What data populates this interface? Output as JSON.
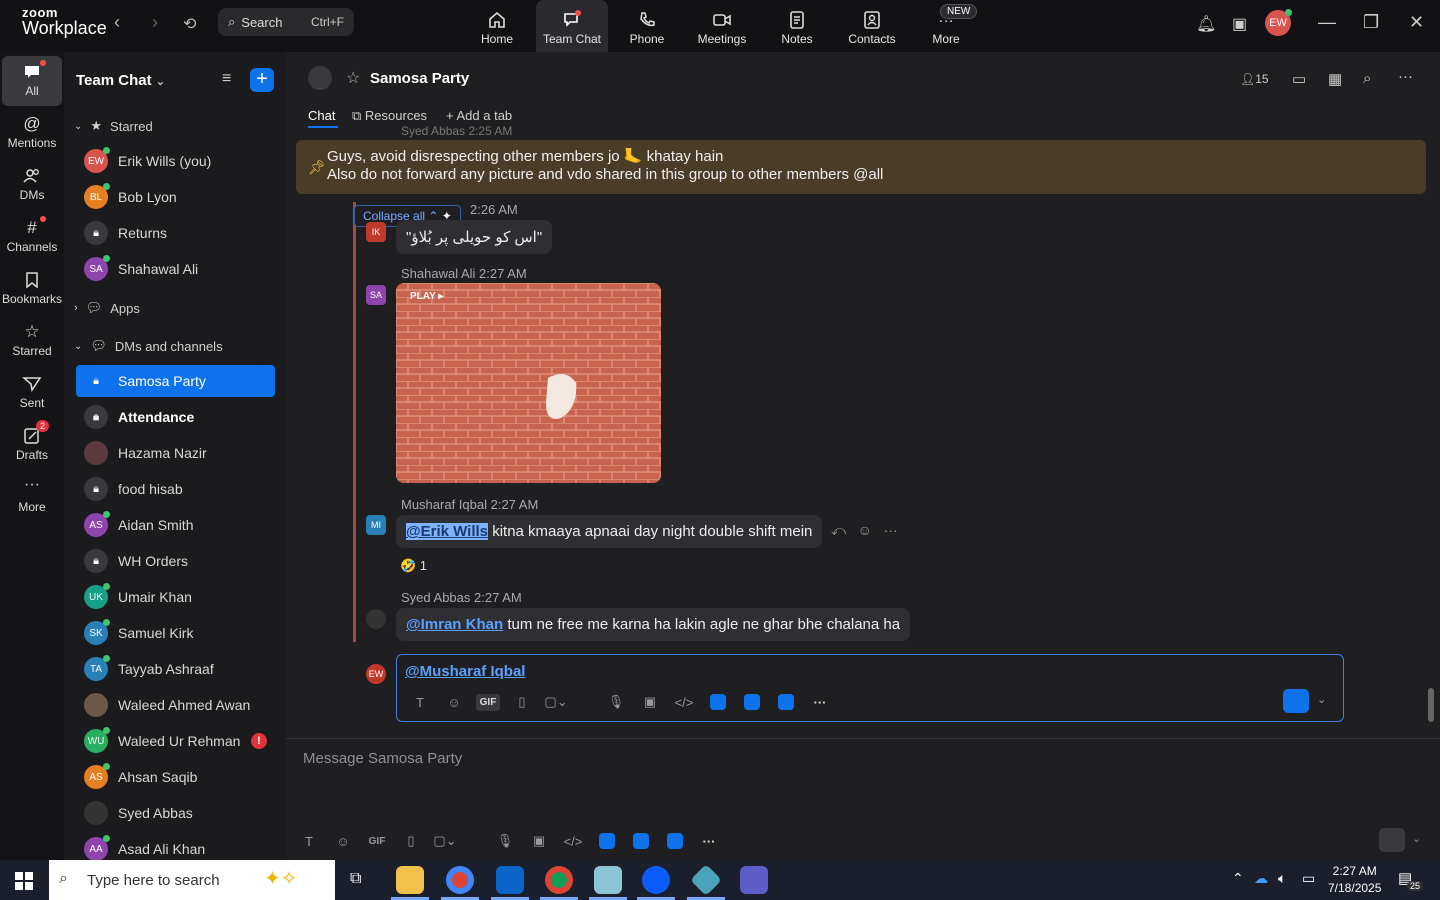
{
  "app": {
    "brand_small": "zoom",
    "brand_big": "Workplace"
  },
  "search": {
    "label": "Search",
    "shortcut": "Ctrl+F"
  },
  "top_tabs": [
    {
      "label": "Home"
    },
    {
      "label": "Team Chat"
    },
    {
      "label": "Phone"
    },
    {
      "label": "Meetings"
    },
    {
      "label": "Notes"
    },
    {
      "label": "Contacts"
    },
    {
      "label": "More"
    }
  ],
  "new_badge": "NEW",
  "profile_initials": "EW",
  "rail": [
    {
      "label": "All"
    },
    {
      "label": "Mentions"
    },
    {
      "label": "DMs"
    },
    {
      "label": "Channels"
    },
    {
      "label": "Bookmarks"
    },
    {
      "label": "Starred"
    },
    {
      "label": "Sent"
    },
    {
      "label": "Drafts"
    },
    {
      "label": "More"
    }
  ],
  "drafts_count": "2",
  "sidebar": {
    "title": "Team Chat",
    "sections": {
      "starred": "Starred",
      "apps": "Apps",
      "dms": "DMs and channels"
    },
    "starred": [
      {
        "label": "Erik Wills (you)",
        "initials": "EW",
        "color": "#d9534f"
      },
      {
        "label": "Bob Lyon",
        "initials": "BL",
        "color": "#e67e22"
      },
      {
        "label": "Returns",
        "initials": "",
        "color": "#3a3a3e"
      },
      {
        "label": "Shahawal Ali",
        "initials": "SA",
        "color": "#8e44ad"
      }
    ],
    "items": [
      {
        "label": "Samosa Party",
        "initials": "",
        "color": ""
      },
      {
        "label": "Attendance",
        "initials": "",
        "color": "#3a3a3e"
      },
      {
        "label": "Hazama Nazir",
        "initials": "",
        "color": "#5a3a3e"
      },
      {
        "label": "food hisab",
        "initials": "",
        "color": "#3a3a3e"
      },
      {
        "label": "Aidan Smith",
        "initials": "AS",
        "color": "#8e44ad"
      },
      {
        "label": "WH Orders",
        "initials": "",
        "color": "#3a3a3e"
      },
      {
        "label": "Umair Khan",
        "initials": "UK",
        "color": "#16a085"
      },
      {
        "label": "Samuel Kirk",
        "initials": "SK",
        "color": "#2980b9"
      },
      {
        "label": "Tayyab Ashraaf",
        "initials": "TA",
        "color": "#2980b9"
      },
      {
        "label": "Waleed Ahmed Awan",
        "initials": "",
        "color": "#6b5a4a"
      },
      {
        "label": "Waleed Ur Rehman",
        "initials": "WU",
        "color": "#27ae60",
        "badge": "!"
      },
      {
        "label": "Ahsan Saqib",
        "initials": "AS",
        "color": "#e67e22"
      },
      {
        "label": "Syed Abbas",
        "initials": "",
        "color": "#333"
      },
      {
        "label": "Asad Ali Khan",
        "initials": "AA",
        "color": "#8e44ad"
      }
    ]
  },
  "channel": {
    "title": "Samosa Party",
    "tabs": {
      "chat": "Chat",
      "resources": "Resources",
      "add": "Add a tab"
    },
    "member_count": "15",
    "pinned_line1": "Guys, avoid disrespecting other members jo 🦶 khatay hain",
    "pinned_line2": "Also do not forward any picture and vdo shared in this group to other members @all",
    "partial_meta": "Syed Abbas 2:25 AM",
    "collapse_all": "Collapse all ⌃",
    "msg1_time": "2:26 AM",
    "msg1_initials": "IK",
    "msg1_text": "\"اس کو حویلی پر بُلاؤ\"",
    "msg2_meta": "Shahawal Ali 2:27 AM",
    "msg2_initials": "SA",
    "play_label": "PLAY ▸",
    "msg3_meta": "Musharaf Iqbal 2:27 AM",
    "msg3_initials": "MI",
    "msg3_mention": "@Erik Wills",
    "msg3_text": " kitna kmaaya apnaai day night double shift mein",
    "msg3_reaction": "🤣 1",
    "msg4_meta": "Syed Abbas 2:27 AM",
    "msg4_mention": "@Imran Khan",
    "msg4_text": " tum ne free me karna ha lakin agle ne ghar bhe chalana ha",
    "reply_initials": "EW",
    "reply_mention": "@Musharaf Iqbal",
    "composer_placeholder": "Message Samosa Party"
  },
  "taskbar": {
    "search_placeholder": "Type here to search",
    "time": "2:27 AM",
    "date": "7/18/2025",
    "notif_count": "25"
  }
}
